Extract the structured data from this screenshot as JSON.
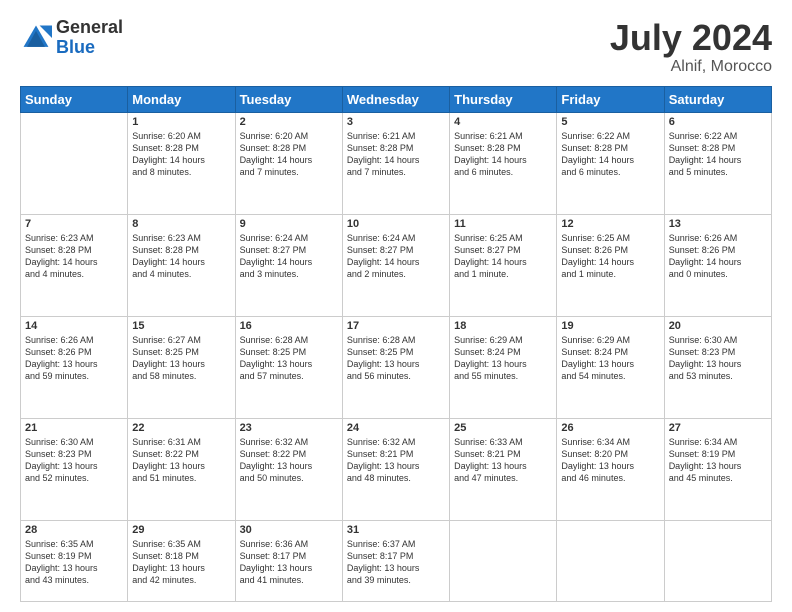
{
  "header": {
    "logo_general": "General",
    "logo_blue": "Blue",
    "title": "July 2024",
    "location": "Alnif, Morocco"
  },
  "weekdays": [
    "Sunday",
    "Monday",
    "Tuesday",
    "Wednesday",
    "Thursday",
    "Friday",
    "Saturday"
  ],
  "weeks": [
    [
      {
        "day": "",
        "info": ""
      },
      {
        "day": "1",
        "info": "Sunrise: 6:20 AM\nSunset: 8:28 PM\nDaylight: 14 hours\nand 8 minutes."
      },
      {
        "day": "2",
        "info": "Sunrise: 6:20 AM\nSunset: 8:28 PM\nDaylight: 14 hours\nand 7 minutes."
      },
      {
        "day": "3",
        "info": "Sunrise: 6:21 AM\nSunset: 8:28 PM\nDaylight: 14 hours\nand 7 minutes."
      },
      {
        "day": "4",
        "info": "Sunrise: 6:21 AM\nSunset: 8:28 PM\nDaylight: 14 hours\nand 6 minutes."
      },
      {
        "day": "5",
        "info": "Sunrise: 6:22 AM\nSunset: 8:28 PM\nDaylight: 14 hours\nand 6 minutes."
      },
      {
        "day": "6",
        "info": "Sunrise: 6:22 AM\nSunset: 8:28 PM\nDaylight: 14 hours\nand 5 minutes."
      }
    ],
    [
      {
        "day": "7",
        "info": "Sunrise: 6:23 AM\nSunset: 8:28 PM\nDaylight: 14 hours\nand 4 minutes."
      },
      {
        "day": "8",
        "info": "Sunrise: 6:23 AM\nSunset: 8:28 PM\nDaylight: 14 hours\nand 4 minutes."
      },
      {
        "day": "9",
        "info": "Sunrise: 6:24 AM\nSunset: 8:27 PM\nDaylight: 14 hours\nand 3 minutes."
      },
      {
        "day": "10",
        "info": "Sunrise: 6:24 AM\nSunset: 8:27 PM\nDaylight: 14 hours\nand 2 minutes."
      },
      {
        "day": "11",
        "info": "Sunrise: 6:25 AM\nSunset: 8:27 PM\nDaylight: 14 hours\nand 1 minute."
      },
      {
        "day": "12",
        "info": "Sunrise: 6:25 AM\nSunset: 8:26 PM\nDaylight: 14 hours\nand 1 minute."
      },
      {
        "day": "13",
        "info": "Sunrise: 6:26 AM\nSunset: 8:26 PM\nDaylight: 14 hours\nand 0 minutes."
      }
    ],
    [
      {
        "day": "14",
        "info": "Sunrise: 6:26 AM\nSunset: 8:26 PM\nDaylight: 13 hours\nand 59 minutes."
      },
      {
        "day": "15",
        "info": "Sunrise: 6:27 AM\nSunset: 8:25 PM\nDaylight: 13 hours\nand 58 minutes."
      },
      {
        "day": "16",
        "info": "Sunrise: 6:28 AM\nSunset: 8:25 PM\nDaylight: 13 hours\nand 57 minutes."
      },
      {
        "day": "17",
        "info": "Sunrise: 6:28 AM\nSunset: 8:25 PM\nDaylight: 13 hours\nand 56 minutes."
      },
      {
        "day": "18",
        "info": "Sunrise: 6:29 AM\nSunset: 8:24 PM\nDaylight: 13 hours\nand 55 minutes."
      },
      {
        "day": "19",
        "info": "Sunrise: 6:29 AM\nSunset: 8:24 PM\nDaylight: 13 hours\nand 54 minutes."
      },
      {
        "day": "20",
        "info": "Sunrise: 6:30 AM\nSunset: 8:23 PM\nDaylight: 13 hours\nand 53 minutes."
      }
    ],
    [
      {
        "day": "21",
        "info": "Sunrise: 6:30 AM\nSunset: 8:23 PM\nDaylight: 13 hours\nand 52 minutes."
      },
      {
        "day": "22",
        "info": "Sunrise: 6:31 AM\nSunset: 8:22 PM\nDaylight: 13 hours\nand 51 minutes."
      },
      {
        "day": "23",
        "info": "Sunrise: 6:32 AM\nSunset: 8:22 PM\nDaylight: 13 hours\nand 50 minutes."
      },
      {
        "day": "24",
        "info": "Sunrise: 6:32 AM\nSunset: 8:21 PM\nDaylight: 13 hours\nand 48 minutes."
      },
      {
        "day": "25",
        "info": "Sunrise: 6:33 AM\nSunset: 8:21 PM\nDaylight: 13 hours\nand 47 minutes."
      },
      {
        "day": "26",
        "info": "Sunrise: 6:34 AM\nSunset: 8:20 PM\nDaylight: 13 hours\nand 46 minutes."
      },
      {
        "day": "27",
        "info": "Sunrise: 6:34 AM\nSunset: 8:19 PM\nDaylight: 13 hours\nand 45 minutes."
      }
    ],
    [
      {
        "day": "28",
        "info": "Sunrise: 6:35 AM\nSunset: 8:19 PM\nDaylight: 13 hours\nand 43 minutes."
      },
      {
        "day": "29",
        "info": "Sunrise: 6:35 AM\nSunset: 8:18 PM\nDaylight: 13 hours\nand 42 minutes."
      },
      {
        "day": "30",
        "info": "Sunrise: 6:36 AM\nSunset: 8:17 PM\nDaylight: 13 hours\nand 41 minutes."
      },
      {
        "day": "31",
        "info": "Sunrise: 6:37 AM\nSunset: 8:17 PM\nDaylight: 13 hours\nand 39 minutes."
      },
      {
        "day": "",
        "info": ""
      },
      {
        "day": "",
        "info": ""
      },
      {
        "day": "",
        "info": ""
      }
    ]
  ]
}
